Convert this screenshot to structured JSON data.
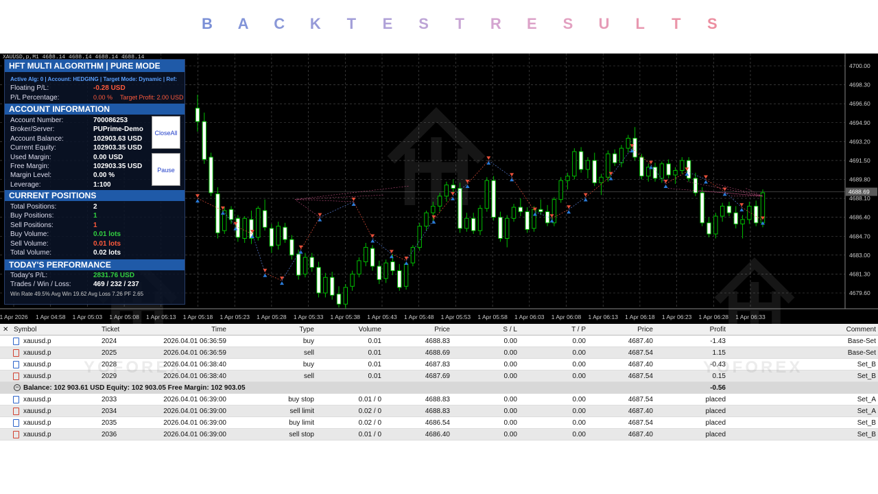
{
  "header": {
    "letters": [
      "B",
      "A",
      "C",
      "K",
      "T",
      "E",
      "S",
      "T",
      "R",
      "E",
      "S",
      "U",
      "L",
      "T",
      "S"
    ],
    "letter_colors": [
      "#7a8fd6",
      "#8294d8",
      "#8a98d8",
      "#969ad8",
      "#a29ed8",
      "#b0a2d8",
      "#bda4d6",
      "#c8a6d4",
      "#d4a4d0",
      "#dca2c8",
      "#e2a0c0",
      "#e69cb8",
      "#e898b0",
      "#ea94a8",
      "#ec8ea0"
    ]
  },
  "chart": {
    "symbol_line": "XAUUSD,p,M1  4688.14  4688.14  4688.14  4688.14",
    "price_labels": [
      "4700.00",
      "4698.30",
      "4696.60",
      "4694.90",
      "4693.20",
      "4691.50",
      "4689.80",
      "4688.10",
      "4686.40",
      "4684.70",
      "4683.00",
      "4681.30",
      "4679.60"
    ],
    "current_price": "4688.69",
    "time_labels": [
      "1 Apr 2026",
      "1 Apr 04:58",
      "1 Apr 05:03",
      "1 Apr 05:08",
      "1 Apr 05:13",
      "1 Apr 05:18",
      "1 Apr 05:23",
      "1 Apr 05:28",
      "1 Apr 05:33",
      "1 Apr 05:38",
      "1 Apr 05:43",
      "1 Apr 05:48",
      "1 Apr 05:53",
      "1 Apr 05:58",
      "1 Apr 06:03",
      "1 Apr 06:08",
      "1 Apr 06:13",
      "1 Apr 06:18",
      "1 Apr 06:23",
      "1 Apr 06:28",
      "1 Apr 06:33"
    ],
    "colors": {
      "bull": "#ffffff",
      "bear": "#ffffff",
      "wick": "#00c000",
      "grid": "#555555",
      "buy_marker": "#2a7bd8",
      "sell_marker": "#e8503a"
    }
  },
  "panel": {
    "title": "HFT MULTI ALGORITHM | PURE MODE",
    "status_line": "Active Alg: 0 | Account: HEDGING | Target Mode: Dynamic | Ref:",
    "floating_label": "Floating P/L:",
    "floating_value": "-0.28 USD",
    "pl_pct_label": "P/L Percentage:",
    "pl_pct_value": "0.00 %",
    "target_profit": "Target Profit: 2.00 USD",
    "account_title": "ACCOUNT INFORMATION",
    "account_rows": [
      {
        "label": "Account Number:",
        "value": "700086253"
      },
      {
        "label": "Broker/Server:",
        "value": "PUPrime-Demo"
      },
      {
        "label": "Account Balance:",
        "value": "102903.63 USD"
      },
      {
        "label": "Current Equity:",
        "value": "102903.35 USD"
      },
      {
        "label": "Used Margin:",
        "value": "0.00 USD"
      },
      {
        "label": "Free Margin:",
        "value": "102903.35 USD"
      },
      {
        "label": "Margin Level:",
        "value": "0.00 %"
      },
      {
        "label": "Leverage:",
        "value": "1:100"
      }
    ],
    "positions_title": "CURRENT POSITIONS",
    "positions_rows": [
      {
        "label": "Total Positions:",
        "value": "2",
        "color": "#ffffff"
      },
      {
        "label": "Buy Positions:",
        "value": "1",
        "color": "#32d040"
      },
      {
        "label": "Sell Positions:",
        "value": "1",
        "color": "#ff5a3c"
      },
      {
        "label": "Buy Volume:",
        "value": "0.01 lots",
        "color": "#32d040"
      },
      {
        "label": "Sell Volume:",
        "value": "0.01 lots",
        "color": "#ff5a3c"
      },
      {
        "label": "Total Volume:",
        "value": "0.02 lots",
        "color": "#ffffff"
      }
    ],
    "perf_title": "TODAY'S PERFORMANCE",
    "perf_rows": [
      {
        "label": "Today's P/L:",
        "value": "2831.76 USD",
        "color": "#32d040"
      },
      {
        "label": "Trades / Win / Loss:",
        "value": "469 / 232 / 237",
        "color": "#ffffff"
      }
    ],
    "stats_line": "Win Rate 49.5%   Avg Win 19.62   Avg Loss 7.26   PF 2.65",
    "closeall_label": "CloseAll",
    "pause_label": "Pause"
  },
  "table": {
    "close_glyph": "✕",
    "headers": {
      "symbol": "Symbol",
      "ticket": "Ticket",
      "time": "Time",
      "type": "Type",
      "volume": "Volume",
      "price": "Price",
      "sl": "S / L",
      "tp": "T / P",
      "price2": "Price",
      "profit": "Profit",
      "comment": "Comment"
    },
    "positions": [
      {
        "symbol": "xauusd.p",
        "ticket": "2024",
        "time": "2026.04.01 06:36:59",
        "type": "buy",
        "volume": "0.01",
        "price": "4688.83",
        "sl": "0.00",
        "tp": "0.00",
        "price2": "4687.40",
        "profit": "-1.43",
        "comment": "Base-Set",
        "icon": "buy"
      },
      {
        "symbol": "xauusd.p",
        "ticket": "2025",
        "time": "2026.04.01 06:36:59",
        "type": "sell",
        "volume": "0.01",
        "price": "4688.69",
        "sl": "0.00",
        "tp": "0.00",
        "price2": "4687.54",
        "profit": "1.15",
        "comment": "Base-Set",
        "icon": "sell"
      },
      {
        "symbol": "xauusd.p",
        "ticket": "2028",
        "time": "2026.04.01 06:38:40",
        "type": "buy",
        "volume": "0.01",
        "price": "4687.83",
        "sl": "0.00",
        "tp": "0.00",
        "price2": "4687.40",
        "profit": "-0.43",
        "comment": "Set_B",
        "icon": "buy"
      },
      {
        "symbol": "xauusd.p",
        "ticket": "2029",
        "time": "2026.04.01 06:38:40",
        "type": "sell",
        "volume": "0.01",
        "price": "4687.69",
        "sl": "0.00",
        "tp": "0.00",
        "price2": "4687.54",
        "profit": "0.15",
        "comment": "Set_B",
        "icon": "sell"
      }
    ],
    "summary": {
      "text": "Balance: 102 903.61 USD  Equity: 102 903.05  Free Margin: 102 903.05",
      "profit": "-0.56"
    },
    "orders": [
      {
        "symbol": "xauusd.p",
        "ticket": "2033",
        "time": "2026.04.01 06:39:00",
        "type": "buy stop",
        "volume": "0.01 / 0",
        "price": "4688.83",
        "sl": "0.00",
        "tp": "0.00",
        "price2": "4687.54",
        "profit": "placed",
        "comment": "Set_A",
        "icon": "buy"
      },
      {
        "symbol": "xauusd.p",
        "ticket": "2034",
        "time": "2026.04.01 06:39:00",
        "type": "sell limit",
        "volume": "0.02 / 0",
        "price": "4688.83",
        "sl": "0.00",
        "tp": "0.00",
        "price2": "4687.40",
        "profit": "placed",
        "comment": "Set_A",
        "icon": "sell"
      },
      {
        "symbol": "xauusd.p",
        "ticket": "2035",
        "time": "2026.04.01 06:39:00",
        "type": "buy limit",
        "volume": "0.02 / 0",
        "price": "4686.54",
        "sl": "0.00",
        "tp": "0.00",
        "price2": "4687.54",
        "profit": "placed",
        "comment": "Set_B",
        "icon": "buy"
      },
      {
        "symbol": "xauusd.p",
        "ticket": "2036",
        "time": "2026.04.01 06:39:00",
        "type": "sell stop",
        "volume": "0.01 / 0",
        "price": "4686.40",
        "sl": "0.00",
        "tp": "0.00",
        "price2": "4687.40",
        "profit": "placed",
        "comment": "Set_B",
        "icon": "sell"
      }
    ]
  },
  "watermark": {
    "brand": "YOFOREX"
  }
}
